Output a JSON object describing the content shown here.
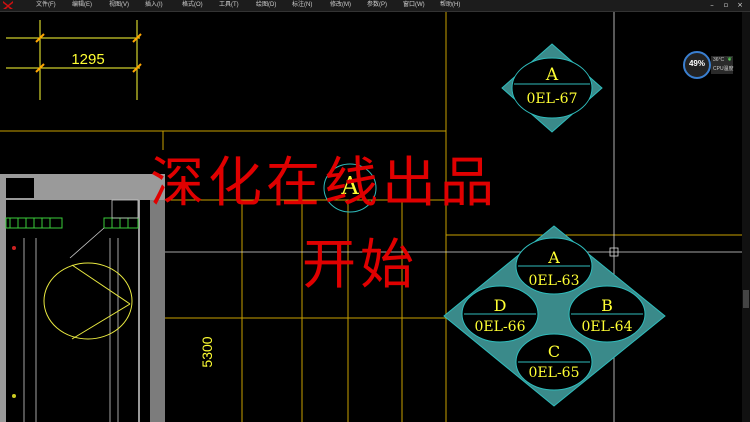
{
  "menu": {
    "items": [
      "文件(F)",
      "编辑(E)",
      "视图(V)",
      "插入(I)",
      "格式(O)",
      "工具(T)",
      "绘图(D)",
      "标注(N)",
      "修改(M)",
      "参数(P)",
      "窗口(W)",
      "帮助(H)"
    ]
  },
  "window_controls": {
    "minimize": "–",
    "restore": "▫",
    "close": "×"
  },
  "drawing": {
    "dimension_top": "1295",
    "dimension_vertical": "5300",
    "tags": {
      "top": {
        "letter": "A",
        "code": "0EL-67"
      },
      "middle": {
        "letter": "A"
      },
      "cluster": [
        {
          "letter": "A",
          "code": "0EL-63"
        },
        {
          "letter": "D",
          "code": "0EL-66"
        },
        {
          "letter": "B",
          "code": "0EL-64"
        },
        {
          "letter": "C",
          "code": "0EL-65"
        }
      ]
    }
  },
  "cpu_widget": {
    "percent": "49%",
    "temperature": "36°C",
    "label": "CPU温度"
  },
  "overlay": {
    "line1": "深化在线出品",
    "line2": "开始"
  },
  "colors": {
    "yellow": "#ffff33",
    "cyan": "#2fbcbc",
    "orange": "#ffa500",
    "red": "#e00000",
    "white": "#e6e6e6"
  }
}
